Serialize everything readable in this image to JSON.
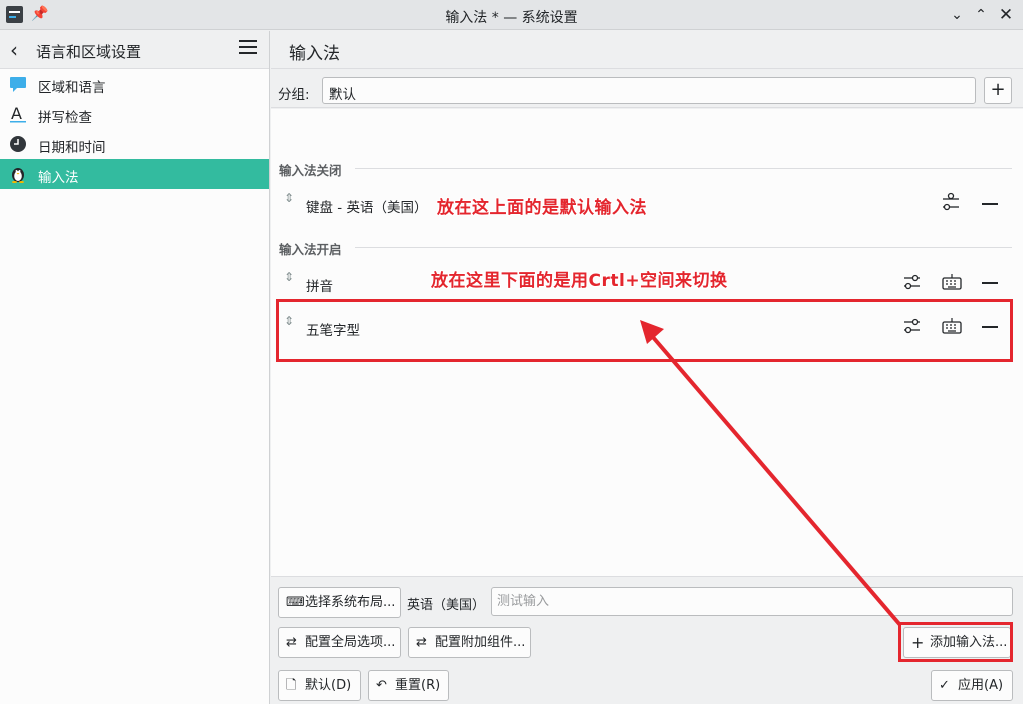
{
  "window": {
    "title": "输入法 * — 系统设置"
  },
  "sidebar": {
    "header": "语言和区域设置",
    "items": [
      {
        "label": "区域和语言",
        "icon": "speech-bubble-icon"
      },
      {
        "label": "拼写检查",
        "icon": "spell-check-icon"
      },
      {
        "label": "日期和时间",
        "icon": "clock-icon"
      },
      {
        "label": "输入法",
        "icon": "penguin-icon"
      }
    ]
  },
  "main": {
    "title": "输入法",
    "group": {
      "label": "分组:",
      "value": "默认"
    },
    "sections": {
      "off": "输入法关闭",
      "on": "输入法开启"
    },
    "methods_off": [
      {
        "name": "键盘 - 英语（美国）"
      }
    ],
    "methods_on": [
      {
        "name": "拼音"
      },
      {
        "name": "五笔字型"
      }
    ],
    "annotations": {
      "top": "放在这上面的是默认输入法",
      "bottom": "放在这里下面的是用Crtl+空间来切换"
    }
  },
  "bottom": {
    "select_layout": "选择系统布局...",
    "layout_name": "英语（美国）",
    "test_placeholder": "测试输入",
    "global_options": "配置全局选项...",
    "addons": "配置附加组件...",
    "add_method": "添加输入法...",
    "defaults": "默认(D)",
    "reset": "重置(R)",
    "apply": "应用(A)"
  },
  "colors": {
    "accent": "#33bb9f",
    "annotation": "#e4262e"
  }
}
